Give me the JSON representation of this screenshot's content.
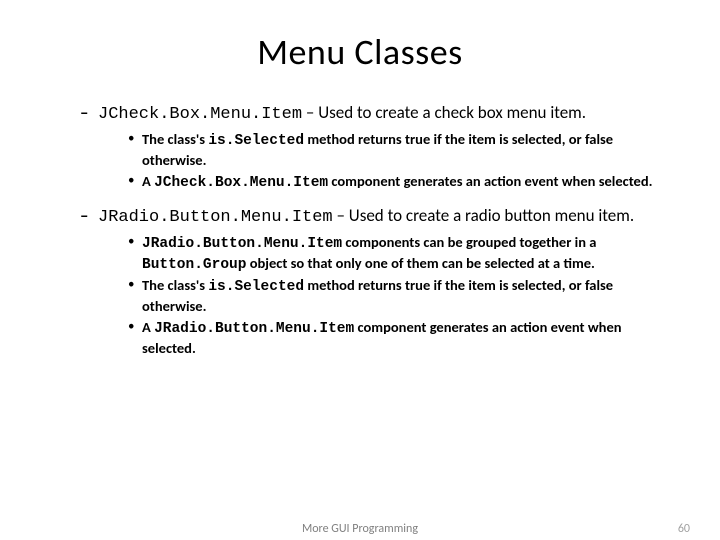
{
  "title": "Menu Classes",
  "items": [
    {
      "class_name": "JCheck.Box.Menu.Item",
      "desc": " – Used to create a check box menu item.",
      "subs": [
        {
          "pre": "The class's ",
          "code": "is.Selected",
          "post": " method returns true if the item is selected, or false otherwise."
        },
        {
          "pre": "A ",
          "code": "JCheck.Box.Menu.Item",
          "post": " component generates an action event when selected."
        }
      ]
    },
    {
      "class_name": "JRadio.Button.Menu.Item",
      "desc": " – Used to create a radio button menu item.",
      "subs": [
        {
          "pre": "",
          "code": "JRadio.Button.Menu.Item",
          "mid": " components can be grouped together in a ",
          "code2": "Button.Group",
          "post": " object so that only one of them can be selected at a time."
        },
        {
          "pre": "The class's ",
          "code": "is.Selected",
          "post": " method returns true if the item is selected, or false otherwise."
        },
        {
          "pre": "A ",
          "code": "JRadio.Button.Menu.Item",
          "post": " component generates an action event when selected."
        }
      ]
    }
  ],
  "footer": {
    "center": "More GUI Programming",
    "page": "60"
  }
}
